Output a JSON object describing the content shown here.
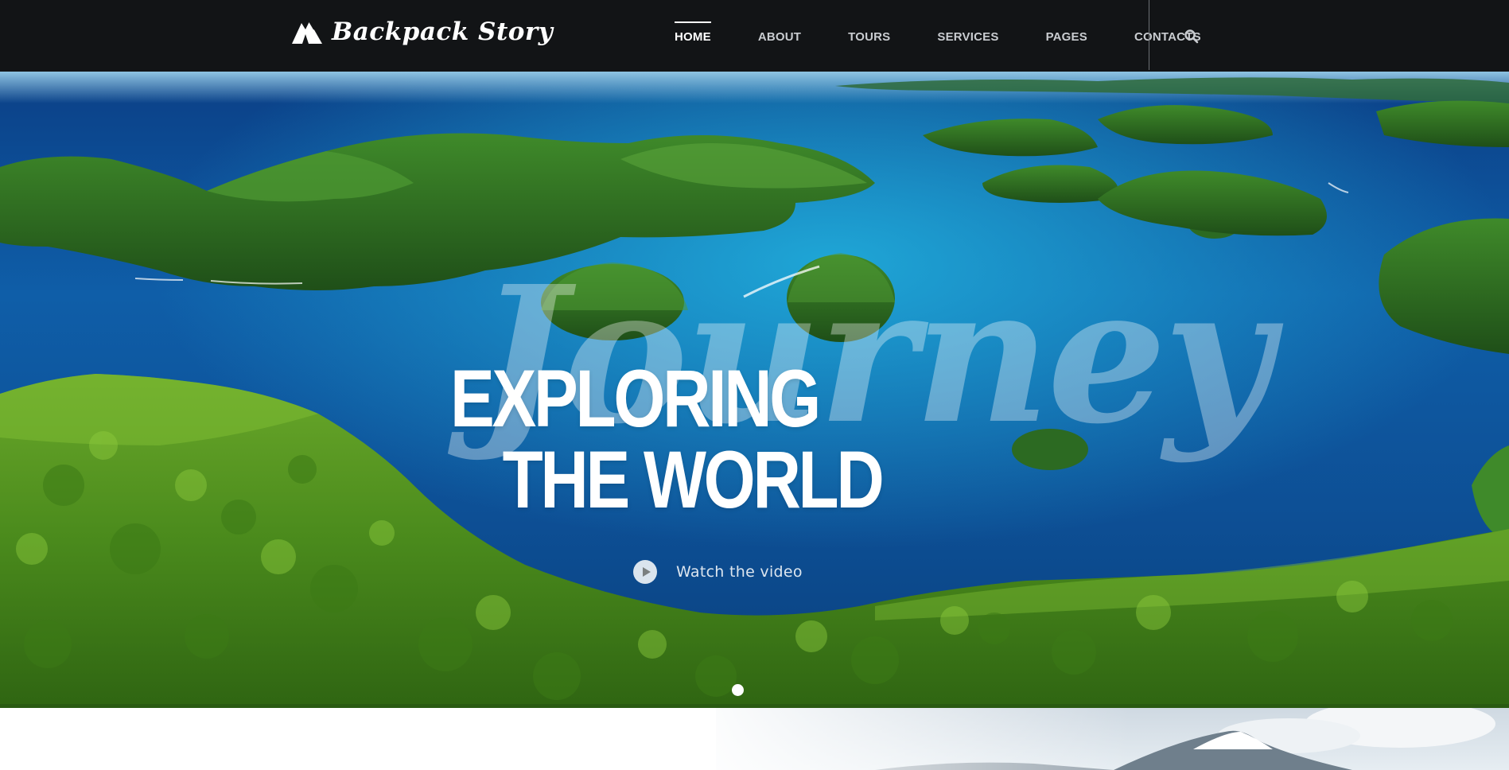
{
  "header": {
    "logo_text": "Backpack Story",
    "nav": [
      {
        "label": "HOME",
        "active": true
      },
      {
        "label": "ABOUT",
        "active": false
      },
      {
        "label": "TOURS",
        "active": false
      },
      {
        "label": "SERVICES",
        "active": false
      },
      {
        "label": "PAGES",
        "active": false
      },
      {
        "label": "CONTACTS",
        "active": false
      }
    ],
    "search_icon": "search-icon"
  },
  "hero": {
    "script_word": "Journey",
    "headline_line1": "EXPLORING",
    "headline_line2": "THE WORLD",
    "video_label": "Watch the video",
    "play_icon": "play-icon",
    "slides_count": 1,
    "active_slide": 1
  },
  "colors": {
    "header_bg": "#121416",
    "nav_text": "#c9ccd0",
    "nav_active": "#ffffff",
    "sea_deep": "#0d4d92",
    "sea_light": "#1595c8",
    "forest": "#4f8f1c"
  }
}
